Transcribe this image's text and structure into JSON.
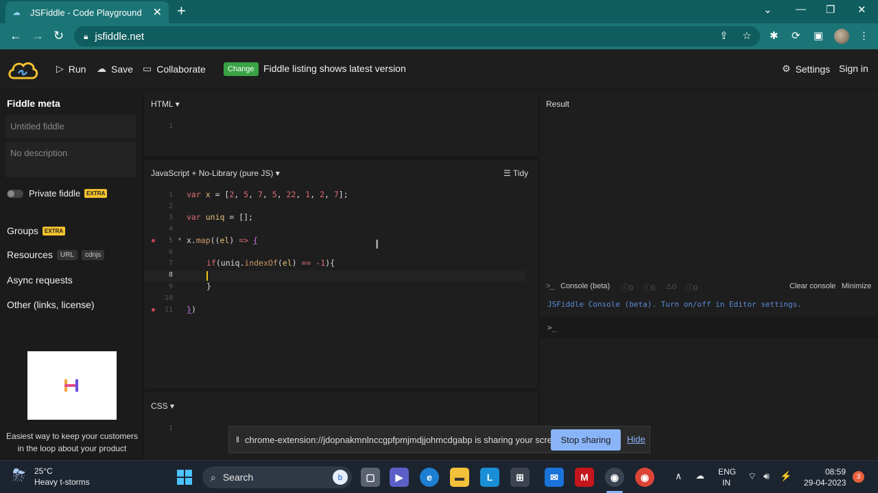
{
  "browser": {
    "tab_title": "JSFiddle - Code Playground",
    "url": "jsfiddle.net",
    "new_tab": "+",
    "tab_close": "✕"
  },
  "header": {
    "run": "Run",
    "save": "Save",
    "collaborate": "Collaborate",
    "change_badge": "Change",
    "listing_text": "Fiddle listing shows latest version",
    "settings": "Settings",
    "sign_in": "Sign in"
  },
  "sidebar": {
    "meta_title": "Fiddle meta",
    "title_placeholder": "Untitled fiddle",
    "desc_placeholder": "No description",
    "private_label": "Private fiddle",
    "extra": "EXTRA",
    "groups": "Groups",
    "resources": "Resources",
    "url_badge": "URL",
    "cdnjs_badge": "cdnjs",
    "async": "Async requests",
    "other": "Other (links, license)",
    "ad_text": "Easiest way to keep your customers in the loop about your product"
  },
  "editors": {
    "html_label": "HTML",
    "js_label": "JavaScript + No-Library (pure JS)",
    "tidy": "Tidy",
    "css_label": "CSS"
  },
  "result": {
    "label": "Result",
    "console_label": "Console (beta)",
    "counts": [
      "0",
      "0",
      "0",
      "0"
    ],
    "clear": "Clear console",
    "minimize": "Minimize",
    "message": "JSFiddle Console (beta). Turn on/off in Editor settings.",
    "prompt": ">_"
  },
  "sharing": {
    "text": "chrome-extension://jdopnakmnlnccgpfpmjmdjjohmcdgabp is sharing your screen.",
    "stop": "Stop sharing",
    "hide": "Hide"
  },
  "taskbar": {
    "temp": "25°C",
    "weather": "Heavy t-storms",
    "search": "Search",
    "lang1": "ENG",
    "lang2": "IN",
    "time": "08:59",
    "date": "29-04-2023",
    "notif_count": "3"
  },
  "colors": {
    "chrome_teal": "#1b7576",
    "change_green": "#39a346",
    "extra_yellow": "#f2c12e",
    "stop_blue": "#8ab4f8"
  }
}
